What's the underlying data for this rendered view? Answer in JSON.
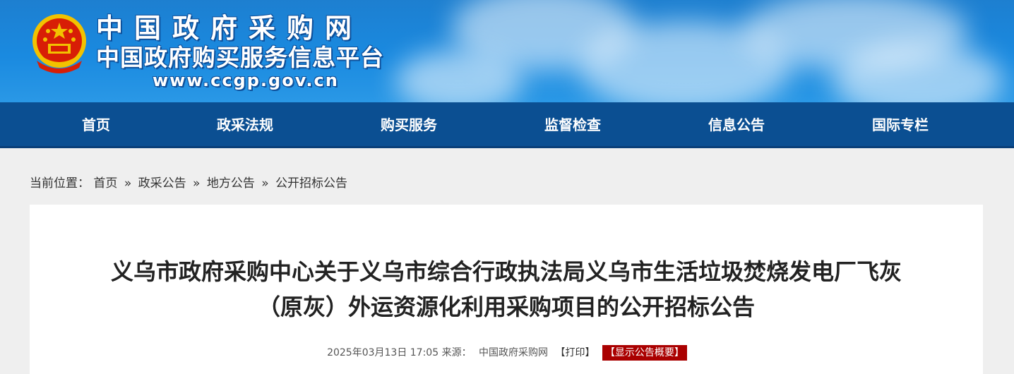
{
  "header": {
    "title": "中国政府采购网",
    "subtitle": "中国政府购买服务信息平台",
    "url": "www.ccgp.gov.cn"
  },
  "nav": {
    "items": [
      "首页",
      "政采法规",
      "购买服务",
      "监督检查",
      "信息公告",
      "国际专栏"
    ]
  },
  "breadcrumb": {
    "prefix": "当前位置：",
    "items": [
      "首页",
      "政采公告",
      "地方公告",
      "公开招标公告"
    ],
    "separator": "»"
  },
  "article": {
    "title_line1": "义乌市政府采购中心关于义乌市综合行政执法局义乌市生活垃圾焚烧发电厂飞灰",
    "title_line2": "（原灰）外运资源化利用采购项目的公开招标公告",
    "date": "2025年03月13日 17:05",
    "source_label": "来源：",
    "source": "中国政府采购网",
    "print": "【打印】",
    "summary_button": "【显示公告概要】"
  },
  "colors": {
    "banner": "#1a8ae0",
    "nav": "#0b4f92",
    "summary_button": "#aa0000"
  },
  "icons": {
    "emblem": "national-emblem-icon"
  }
}
